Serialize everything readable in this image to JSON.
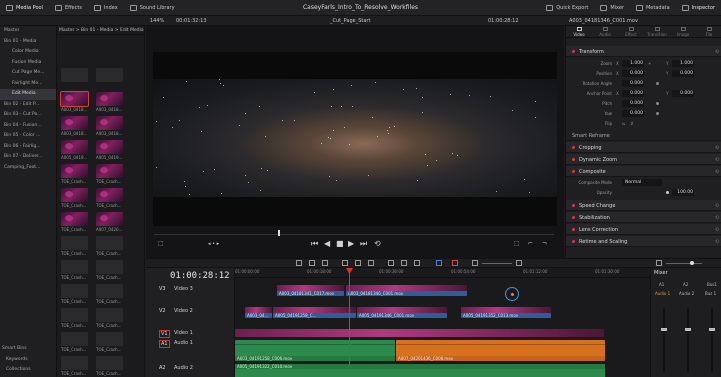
{
  "app": {
    "project_title": "CaseyFarls_Intro_To_Resolve_Workfiles"
  },
  "toolbar": {
    "left": [
      {
        "label": "Media Pool",
        "icon": "media-pool-icon"
      },
      {
        "label": "Effects",
        "icon": "effects-icon"
      },
      {
        "label": "Index",
        "icon": "index-icon"
      },
      {
        "label": "Sound Library",
        "icon": "sound-library-icon"
      }
    ],
    "right": [
      {
        "label": "Quick Export",
        "icon": "quick-export-icon"
      },
      {
        "label": "Mixer",
        "icon": "mixer-icon"
      },
      {
        "label": "Metadata",
        "icon": "metadata-icon"
      },
      {
        "label": "Inspector",
        "icon": "inspector-icon"
      }
    ]
  },
  "subbar": {
    "zoom": "144%",
    "duration": "00:01:32:13",
    "timeline_name": "_Cut_Page_Start",
    "timecode": "01:00:28:12",
    "clip_name": "A003_04181346_C001.mov"
  },
  "bins": {
    "header": "Master",
    "items": [
      "Bin 01 - Media",
      "Color Media",
      "Fusion Media",
      "Cut Page Me...",
      "Fairlight Me...",
      "Edit Media",
      "Bin 02 - Edit P...",
      "Bin 03 - Cut Pa...",
      "Bin 04 - Fusion...",
      "Bin 05 - Color ...",
      "Bin 06 - Fairlig...",
      "Bin 07 - Deliver...",
      "Camping_Foot..."
    ],
    "selected_index": 5,
    "smart_bins": {
      "header": "Smart Bins",
      "items": [
        "Keywords",
        "Collections"
      ]
    }
  },
  "media_pool": {
    "path": "Master > Bin 01 - Media > Edit Media",
    "clips": [
      {
        "name": "",
        "type": "empty"
      },
      {
        "name": "",
        "type": "empty"
      },
      {
        "name": "A003_0418...",
        "type": "img",
        "selected": true
      },
      {
        "name": "A003_0418...",
        "type": "img"
      },
      {
        "name": "A003_0418...",
        "type": "img"
      },
      {
        "name": "A003_0418...",
        "type": "img"
      },
      {
        "name": "A005_0419...",
        "type": "img"
      },
      {
        "name": "A005_0419...",
        "type": "img"
      },
      {
        "name": "TOE_Crash...",
        "type": "img"
      },
      {
        "name": "TOE_Crash...",
        "type": "img"
      },
      {
        "name": "TOE_Crash...",
        "type": "img"
      },
      {
        "name": "TOE_Crash...",
        "type": "img"
      },
      {
        "name": "TOE_Crash...",
        "type": "img"
      },
      {
        "name": "A007_0420...",
        "type": "img"
      },
      {
        "name": "TOE_Crash...",
        "type": "empty"
      },
      {
        "name": "TOE_Crash...",
        "type": "empty"
      },
      {
        "name": "TOE_Crash...",
        "type": "empty"
      },
      {
        "name": "TOE_Crash...",
        "type": "empty"
      },
      {
        "name": "TOE_Crash...",
        "type": "empty"
      },
      {
        "name": "TOE_Crash...",
        "type": "empty"
      },
      {
        "name": "TOE_Crash...",
        "type": "empty"
      },
      {
        "name": "TOE_Crash...",
        "type": "empty"
      },
      {
        "name": "TOE_Crash...",
        "type": "empty"
      },
      {
        "name": "TOE_Crash...",
        "type": "empty"
      },
      {
        "name": "TOE_Crash...",
        "type": "empty"
      },
      {
        "name": "TOE_Crash...",
        "type": "empty"
      }
    ]
  },
  "inspector": {
    "tabs": [
      "Video",
      "Audio",
      "Effect",
      "Transition",
      "Image",
      "File"
    ],
    "active_tab": "Video",
    "transform": {
      "label": "Transform",
      "zoom_label": "Zoom",
      "zoom_x": "1.000",
      "zoom_y": "1.000",
      "position_label": "Position",
      "position_x": "0.000",
      "position_y": "0.000",
      "rotation_label": "Rotation Angle",
      "rotation": "0.000",
      "anchor_label": "Anchor Point",
      "anchor_x": "0.000",
      "anchor_y": "0.000",
      "pitch_label": "Pitch",
      "pitch": "0.000",
      "yaw_label": "Yaw",
      "yaw": "0.000",
      "flip_label": "Flip"
    },
    "sections": {
      "smart_reframe": "Smart Reframe",
      "cropping": "Cropping",
      "dynamic_zoom": "Dynamic Zoom",
      "composite": "Composite",
      "composite_mode_label": "Composite Mode",
      "composite_mode": "Normal",
      "opacity_label": "Opacity",
      "opacity": "100.00",
      "speed_change": "Speed Change",
      "stabilization": "Stabilization",
      "lens_correction": "Lens Correction",
      "retime_scaling": "Retime and Scaling"
    }
  },
  "timeline": {
    "timecode": "01:00:28:12",
    "ruler": [
      "01:00:00:00",
      "01:00:18:00",
      "01:00:36:00",
      "01:00:54:00",
      "01:01:12:00",
      "01:01:30:00"
    ],
    "tracks": [
      {
        "id": "V3",
        "name": "Video 3"
      },
      {
        "id": "V2",
        "name": "Video 2"
      },
      {
        "id": "V1",
        "name": "Video 1"
      },
      {
        "id": "A1",
        "name": "Audio 1",
        "vol": "2.0"
      },
      {
        "id": "A2",
        "name": "Audio 2",
        "vol": "2.0"
      }
    ],
    "clips": {
      "v3_a": "A003_04181341_C017.mov",
      "v3_b": "A003_04181346_C001.mov",
      "v2_a": "A003_04...",
      "v2_b": "A005_04191258_C...",
      "v2_c": "A005_04191346_C001.mov",
      "v2_d": "A005_04191352_C013.mov",
      "a1_a": "A003_04191258_C006.mov",
      "a1_b": "A007_04201436_C008.mov",
      "a2_a": "A005_04191322_C010.mov"
    }
  },
  "mixer": {
    "title": "Mixer",
    "channels": [
      "A1",
      "A2",
      "Bus1"
    ],
    "channel_sub": [
      "Audio 1",
      "Audio 2",
      "Bus 1"
    ]
  },
  "colors": {
    "accent_red": "#d23b3b",
    "clip_blue": "#3a6aa6",
    "audio_green": "#2b8a4c",
    "audio_orange": "#d8711e"
  }
}
